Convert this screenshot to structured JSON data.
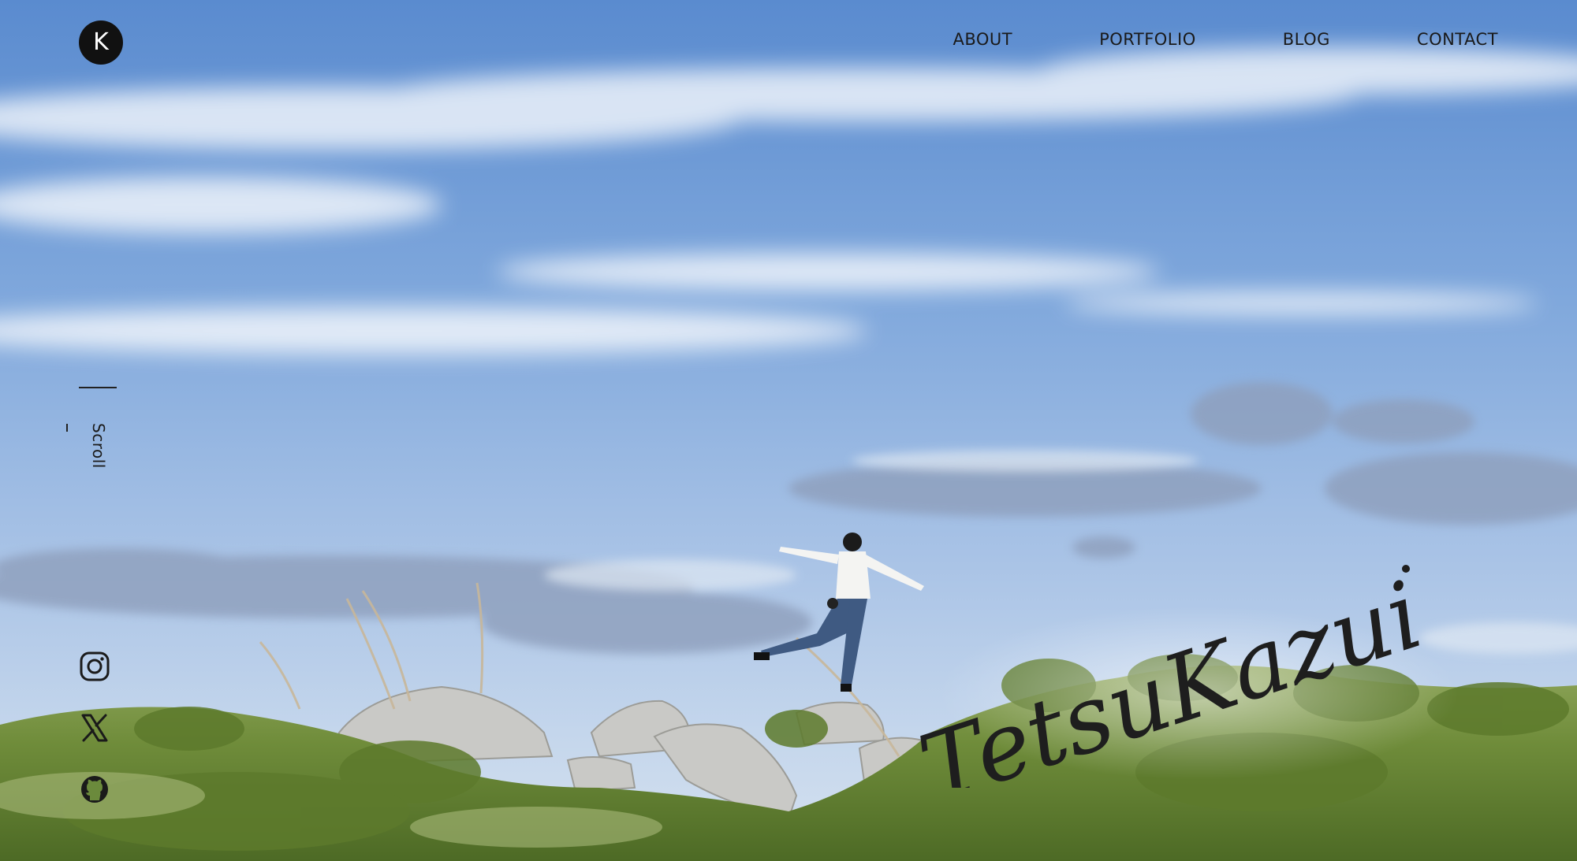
{
  "site": {
    "logo_letter": "K"
  },
  "nav": {
    "items": [
      {
        "label": "ABOUT"
      },
      {
        "label": "PORTFOLIO"
      },
      {
        "label": "BLOG"
      },
      {
        "label": "CONTACT"
      }
    ]
  },
  "scroll": {
    "label": "Scroll"
  },
  "social": {
    "icons": [
      "instagram-icon",
      "x-icon",
      "github-icon"
    ]
  },
  "hero": {
    "signature": "TetsuKazui"
  },
  "colors": {
    "text": "#1a1a1a",
    "logo_bg": "#111111",
    "sky_top": "#5f8fd0",
    "sky_bottom": "#d6e2ef",
    "grass": "#6f8f3a"
  }
}
